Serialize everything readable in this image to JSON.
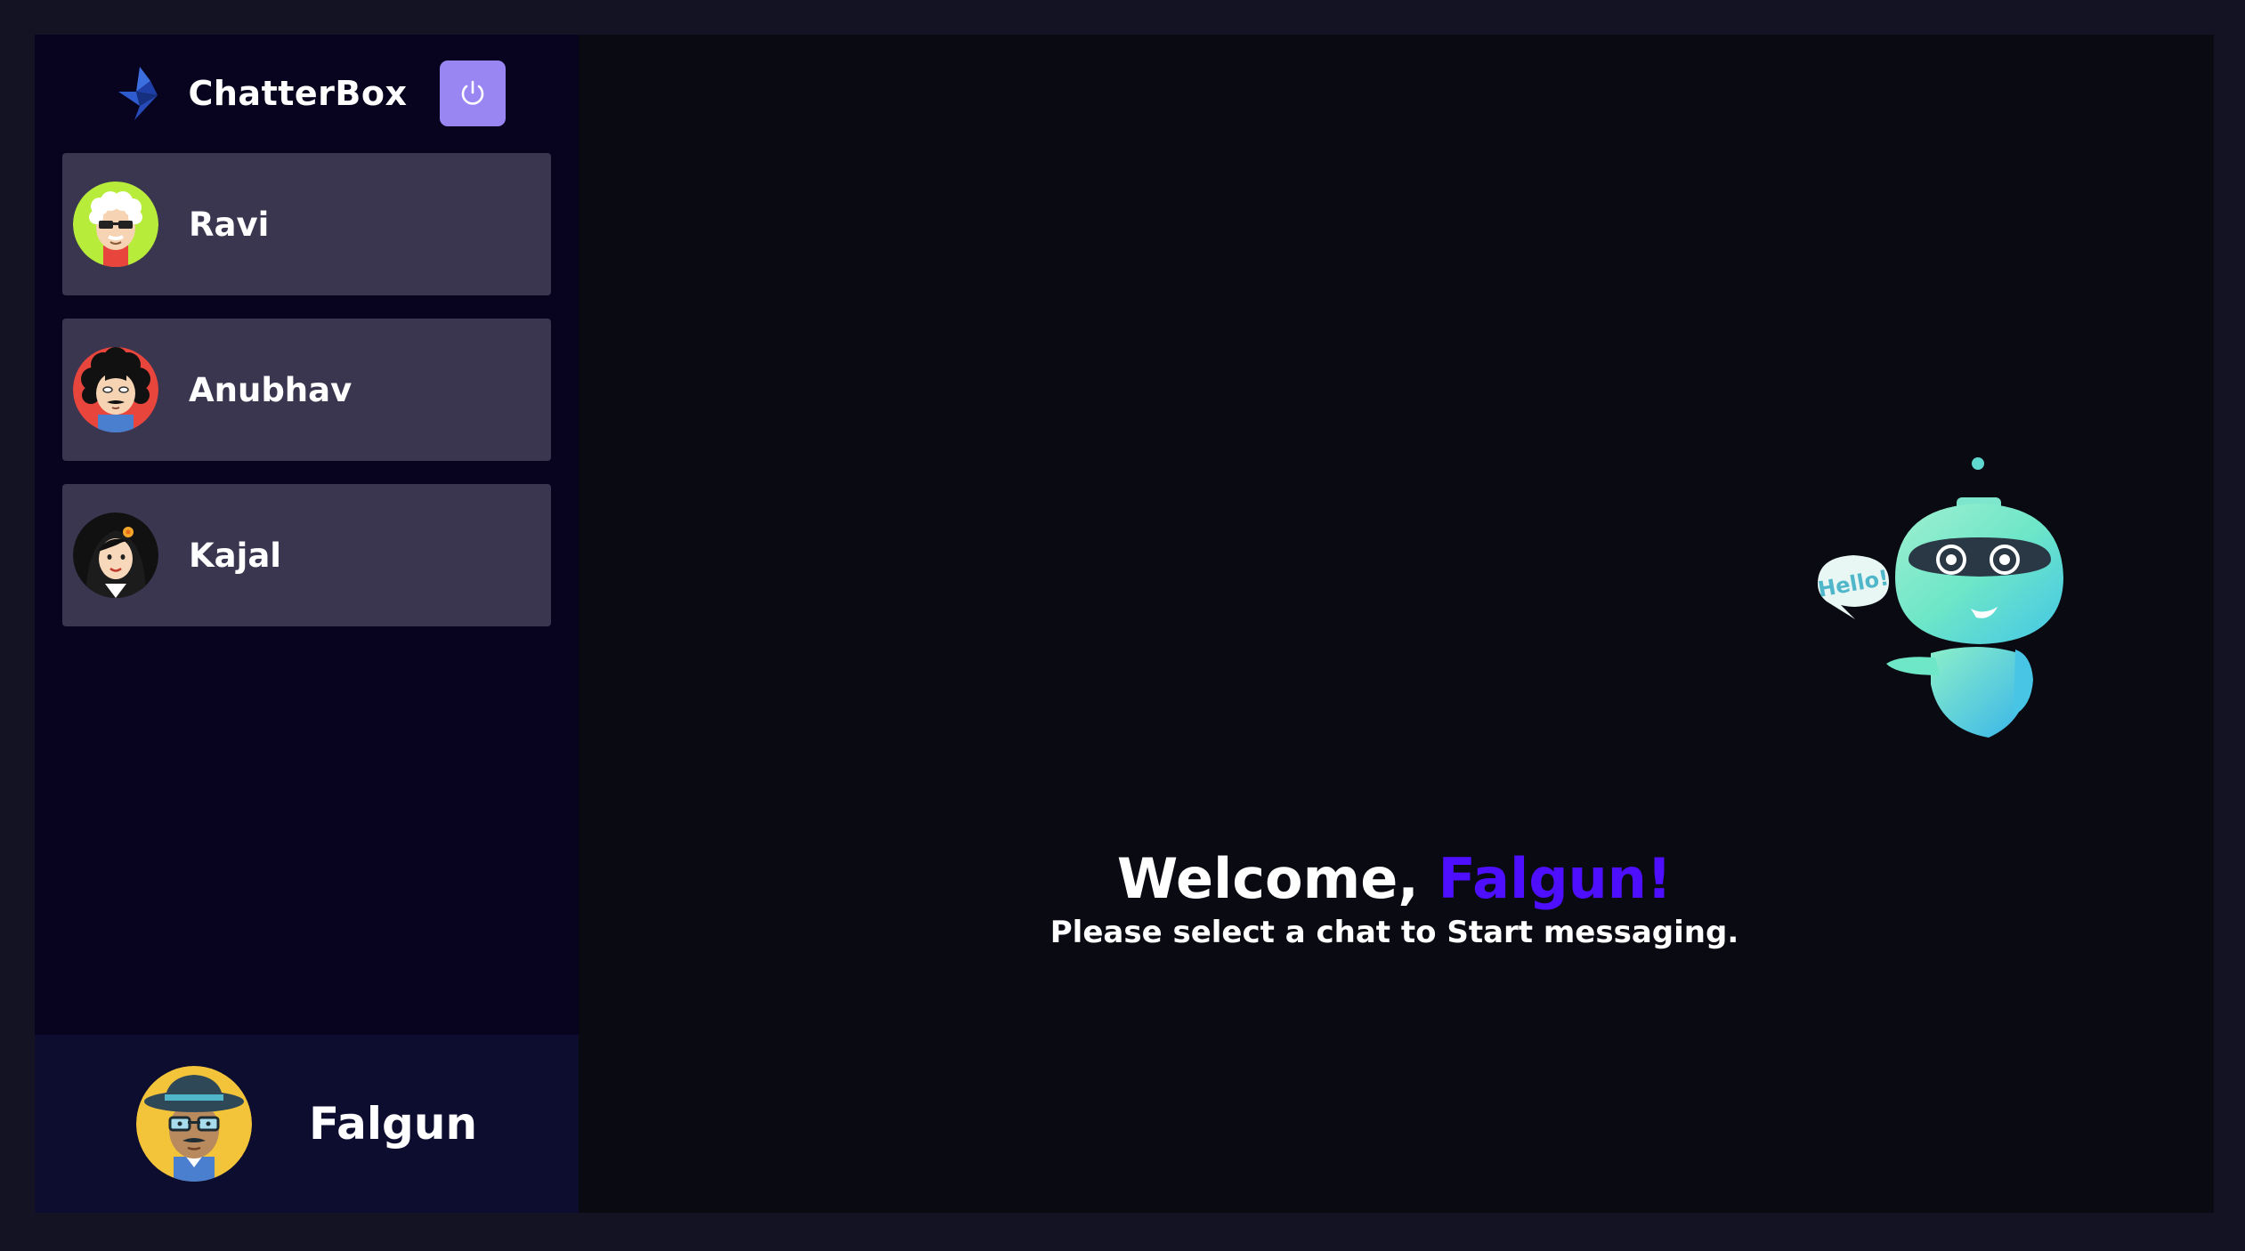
{
  "app": {
    "brand_name": "ChatterBox"
  },
  "contacts": [
    {
      "name": "Ravi",
      "avatar_icon": "avatar-white-hair-sunglasses-icon",
      "avatar_bg": "#b8ec3a"
    },
    {
      "name": "Anubhav",
      "avatar_icon": "avatar-curly-hair-mustache-icon",
      "avatar_bg": "#e8453c"
    },
    {
      "name": "Kajal",
      "avatar_icon": "avatar-woman-flower-icon",
      "avatar_bg": "#111111"
    }
  ],
  "current_user": {
    "name": "Falgun",
    "avatar_icon": "avatar-hat-glasses-icon",
    "avatar_bg": "#f3c43a"
  },
  "welcome": {
    "greeting": "Welcome, ",
    "username": "Falgun!",
    "subtitle": "Please select a chat to Start messaging.",
    "bubble_text": "Hello!"
  },
  "colors": {
    "accent": "#4e0eff",
    "logout": "#9a86f3",
    "contact_bg": "#3a3650",
    "sidebar_bg": "#080420",
    "user_bar_bg": "#0d0d30"
  }
}
